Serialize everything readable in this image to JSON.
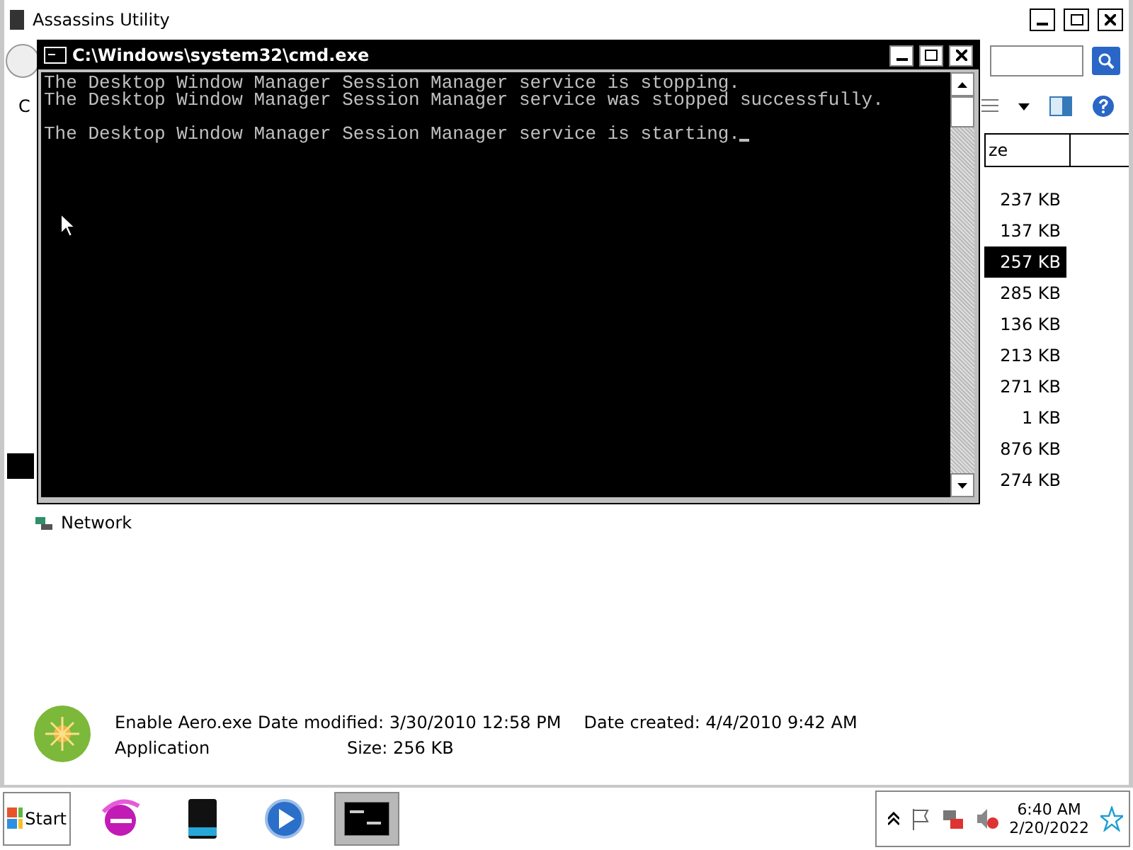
{
  "explorer": {
    "title": "Assassins Utility",
    "toolbar_text": "C",
    "column_header": "ze",
    "sizes": [
      {
        "text": "237 KB",
        "selected": false
      },
      {
        "text": "137 KB",
        "selected": false
      },
      {
        "text": "257 KB",
        "selected": true
      },
      {
        "text": "285 KB",
        "selected": false
      },
      {
        "text": "136 KB",
        "selected": false
      },
      {
        "text": "213 KB",
        "selected": false
      },
      {
        "text": "271 KB",
        "selected": false
      },
      {
        "text": "1 KB",
        "selected": false
      },
      {
        "text": "876 KB",
        "selected": false
      },
      {
        "text": "274 KB",
        "selected": false
      }
    ],
    "nav_items": [
      {
        "label": "Network"
      }
    ],
    "details": {
      "name": "Enable Aero.exe",
      "modified": "Date modified: 3/30/2010 12:58 PM",
      "created": "Date created: 4/4/2010 9:42 AM",
      "type": "Application",
      "size": "Size: 256 KB"
    }
  },
  "console": {
    "title": "C:\\Windows\\system32\\cmd.exe",
    "paragraphs": [
      [
        "The Desktop Window Manager Session Manager service is stopping.",
        "The Desktop Window Manager Session Manager service was stopped successfully."
      ],
      [
        "The Desktop Window Manager Session Manager service is starting."
      ]
    ]
  },
  "taskbar": {
    "start": "Start",
    "apps": [
      {
        "kind": "browser",
        "selected": false
      },
      {
        "kind": "drive",
        "selected": false
      },
      {
        "kind": "media",
        "selected": false
      },
      {
        "kind": "console",
        "selected": true
      }
    ],
    "clock": {
      "time": "6:40 AM",
      "date": "2/20/2022"
    }
  }
}
